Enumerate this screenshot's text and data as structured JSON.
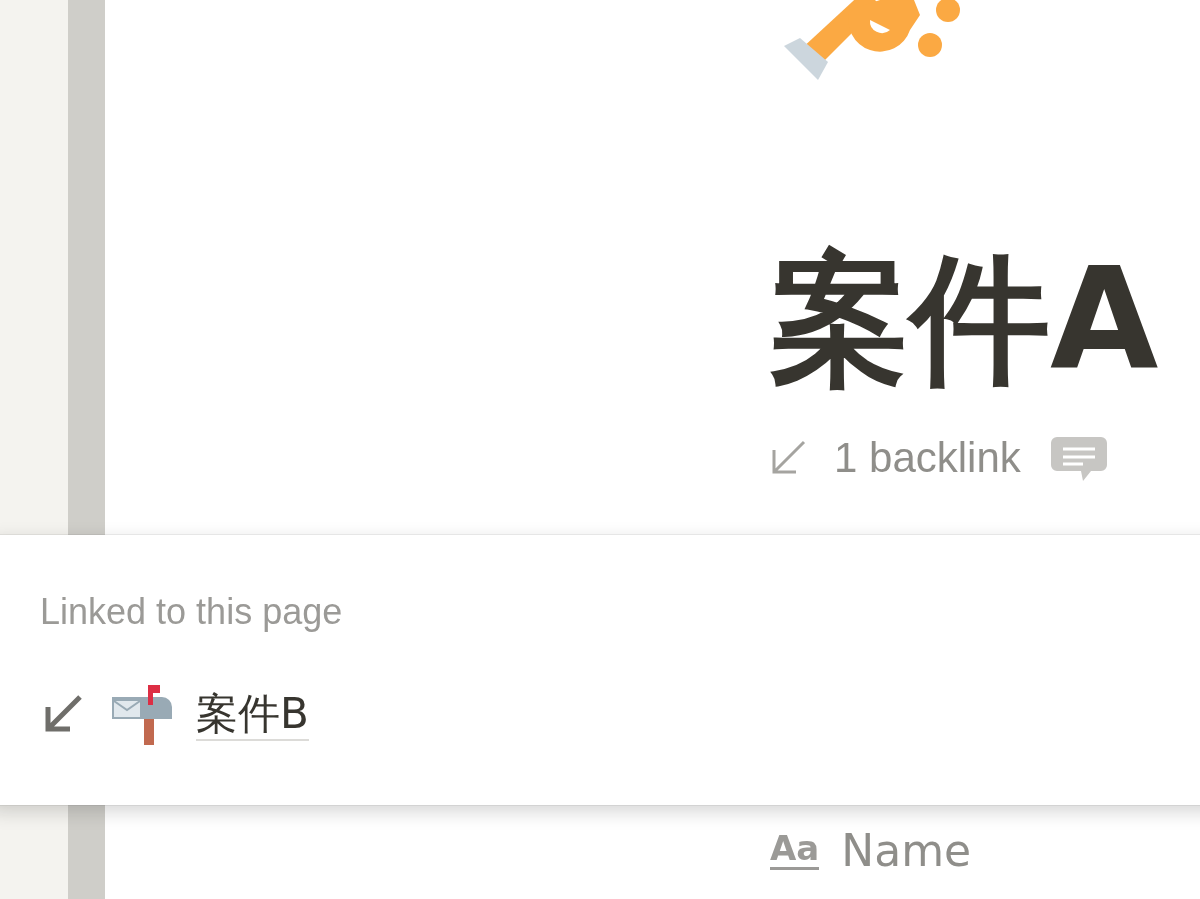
{
  "page": {
    "title": "案件A",
    "backlinks": "1 backlink"
  },
  "popup": {
    "heading": "Linked to this page",
    "links": [
      {
        "title": "案件B"
      }
    ]
  },
  "properties": [
    {
      "type_icon": "Aa",
      "name": "Name"
    }
  ]
}
